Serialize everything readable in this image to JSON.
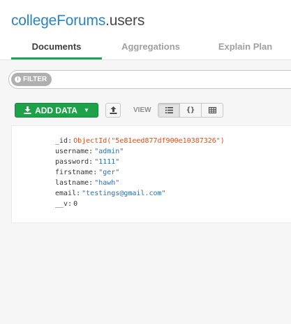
{
  "header": {
    "database": "collegeForums",
    "separator": ".",
    "collection": "users"
  },
  "tabs": [
    {
      "label": "Documents",
      "active": true
    },
    {
      "label": "Aggregations",
      "active": false
    },
    {
      "label": "Explain Plan",
      "active": false
    }
  ],
  "query": {
    "filter_label": "FILTER"
  },
  "toolbar": {
    "add_data_label": "ADD DATA",
    "view_label": "VIEW",
    "view_modes": [
      "list-view",
      "json-view",
      "table-view"
    ],
    "active_view": "list-view"
  },
  "document": {
    "fields": [
      {
        "key": "_id",
        "value": "ObjectId(\"5e81eed877df900e10387326\")",
        "type": "objectid"
      },
      {
        "key": "username",
        "value": "\"admin\"",
        "type": "string"
      },
      {
        "key": "password",
        "value": "\"1111\"",
        "type": "string"
      },
      {
        "key": "firstname",
        "value": "\"ger\"",
        "type": "string"
      },
      {
        "key": "lastname",
        "value": "\"hawh\"",
        "type": "string"
      },
      {
        "key": "email",
        "value": "\"testings@gmail.com\"",
        "type": "string"
      },
      {
        "key": "__v",
        "value": "0",
        "type": "number"
      }
    ]
  },
  "colors": {
    "accent_green": "#1da24a",
    "tab_underline": "#1ea25c",
    "db_name_blue": "#2b84c2",
    "objectid_orange": "#e04e1a",
    "string_blue": "#2d6fb0"
  }
}
